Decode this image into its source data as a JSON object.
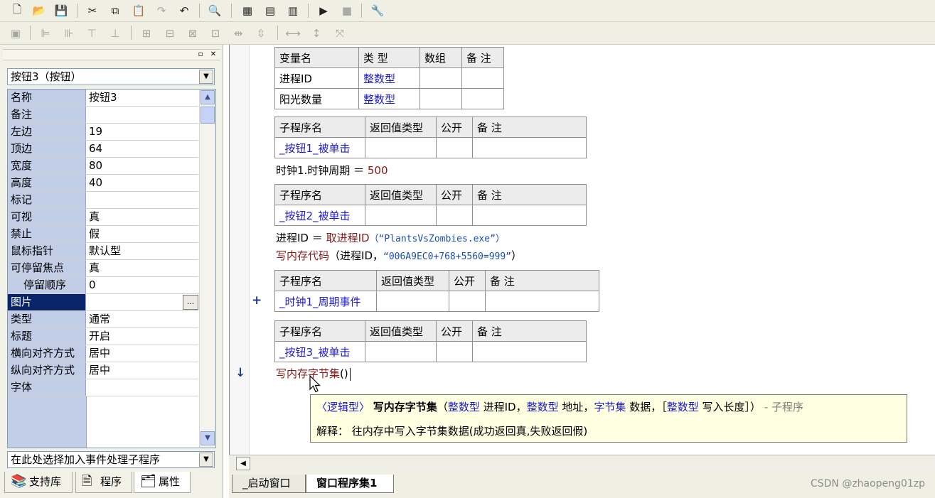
{
  "toolbar1": {
    "icons": [
      "new-file-icon",
      "open-folder-icon",
      "save-icon",
      "cut-icon",
      "copy-icon",
      "paste-icon",
      "redo-icon",
      "undo-icon",
      "find-icon",
      "layout-left-icon",
      "layout-top-icon",
      "layout-grid-icon",
      "run-icon",
      "stop-icon",
      "debug-icon"
    ]
  },
  "properties": {
    "selector": "按钮3（按钮）",
    "rows": [
      {
        "name": "名称",
        "value": "按钮3"
      },
      {
        "name": "备注",
        "value": ""
      },
      {
        "name": "左边",
        "value": "19"
      },
      {
        "name": "顶边",
        "value": "64"
      },
      {
        "name": "宽度",
        "value": "80"
      },
      {
        "name": "高度",
        "value": "40"
      },
      {
        "name": "标记",
        "value": ""
      },
      {
        "name": "可视",
        "value": "真"
      },
      {
        "name": "禁止",
        "value": "假"
      },
      {
        "name": "鼠标指针",
        "value": "默认型"
      },
      {
        "name": "可停留焦点",
        "value": "真"
      },
      {
        "name": "停留顺序",
        "value": "0"
      },
      {
        "name": "图片",
        "value": ""
      },
      {
        "name": "类型",
        "value": "通常"
      },
      {
        "name": "标题",
        "value": "开启"
      },
      {
        "name": "横向对齐方式",
        "value": "居中"
      },
      {
        "name": "纵向对齐方式",
        "value": "居中"
      },
      {
        "name": "字体",
        "value": ""
      }
    ],
    "event_selector": "在此处选择加入事件处理子程序",
    "ellipsis": "..."
  },
  "left_tabs": [
    {
      "label": "支持库"
    },
    {
      "label": "程序"
    },
    {
      "label": "属性"
    }
  ],
  "code": {
    "var_table": {
      "headers": [
        "变量名",
        "类 型",
        "数组",
        "备 注"
      ],
      "rows": [
        [
          "进程ID",
          "整数型",
          "",
          ""
        ],
        [
          "阳光数量",
          "整数型",
          "",
          ""
        ]
      ]
    },
    "sub_headers": [
      "子程序名",
      "返回值类型",
      "公开",
      "备 注"
    ],
    "sub1": "_按钮1_被单击",
    "line1": {
      "left": "时钟1.时钟周期",
      "op": "＝",
      "value": "500"
    },
    "sub2": "_按钮2_被单击",
    "line2": {
      "left": "进程ID",
      "op": "＝",
      "cmd": "取进程ID",
      "args": "（“PlantsVsZombies.exe”）"
    },
    "line3": {
      "cmd": "写内存代码",
      "args1": "（进程ID，",
      "args2": "“006A9EC0+768+5560=999”",
      "args3": "）"
    },
    "sub3": "_时钟1_周期事件",
    "sub4": "_按钮3_被单击",
    "line4": {
      "cmd": "写内存字节集",
      "args": "()"
    },
    "gutter_plus": "+",
    "gutter_arrow": "↓"
  },
  "tooltip": {
    "ret": "〈逻辑型〉",
    "name": "写内存字节集",
    "open": "（",
    "t1": "整数型",
    "p1": "进程ID，",
    "t2": "整数型",
    "p2": "地址，",
    "t3": "字节集",
    "p3": "数据，［",
    "t4": "整数型",
    "p4": "写入长度］）",
    "kind": "- 子程序",
    "explain_label": "解释：",
    "explain": "往内存中写入字节集数据(成功返回真,失败返回假)"
  },
  "editor_tabs": [
    {
      "label": "_启动窗口"
    },
    {
      "label": "窗口程序集1"
    }
  ],
  "watermark": "CSDN @zhaopeng01zp"
}
